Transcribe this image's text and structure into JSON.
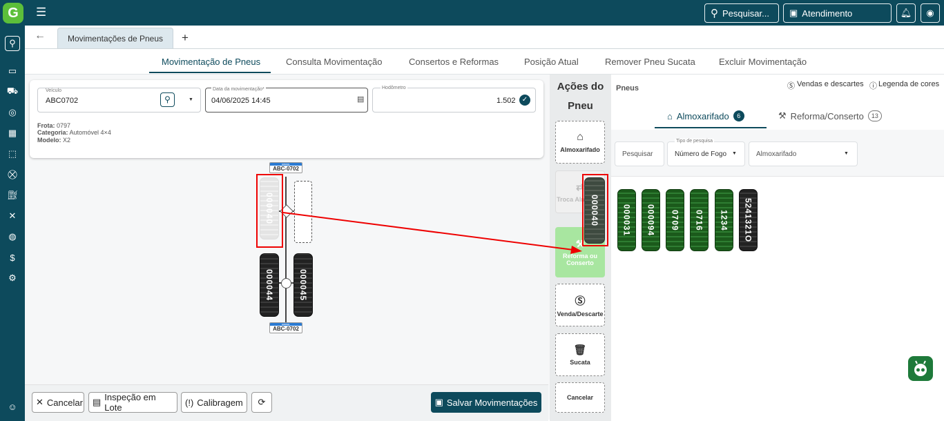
{
  "brand_colors": {
    "primary": "#0d4a5c",
    "accent": "#5cbf3a",
    "highlight": "#e00000"
  },
  "topbar": {
    "search_label": "Pesquisar...",
    "support_label": "Atendimento"
  },
  "sidebar": {
    "icons": [
      "search-icon",
      "archive-icon",
      "truck-icon",
      "tire-icon",
      "calculator-icon",
      "box-icon",
      "cart-icon",
      "fuel-icon",
      "tools-icon",
      "tires-icon",
      "document-money-icon",
      "settings-icon",
      "user-support-icon"
    ]
  },
  "tabs": {
    "active_label": "Movimentações de Pneus",
    "add": "+"
  },
  "subnav": {
    "items": [
      "Movimentação de Pneus",
      "Consulta Movimentação",
      "Consertos e Reformas",
      "Posição Atual",
      "Remover Pneu Sucata",
      "Excluir Movimentação"
    ]
  },
  "form": {
    "vehicle_label": "Veículo",
    "vehicle_value": "ABC0702",
    "date_label": "Data da movimentação*",
    "date_value": "04/06/2025 14:45",
    "odometer_label": "Hodômetro",
    "odometer_value": "1.502"
  },
  "vehicle_info": {
    "frota_label": "Frota:",
    "frota": "0797",
    "categoria_label": "Categoria:",
    "categoria": "Automóvel 4×4",
    "modelo_label": "Modelo:",
    "modelo": "X2"
  },
  "diagram": {
    "plate": "ABC-0702",
    "plate_country": "BRASIL",
    "tire_front_left": "000040",
    "tire_rear_left": "000044",
    "tire_rear_right": "000045"
  },
  "bottom": {
    "cancel": "Cancelar",
    "batch": "Inspeção em Lote",
    "calibration": "Calibragem",
    "save": "Salvar Movimentações"
  },
  "actions": {
    "title_line1": "Ações do",
    "title_line2": "Pneu",
    "almox": "Almoxarifado",
    "troca": "Troca Almoxarif",
    "reforma": "Reforma ou Conserto",
    "venda": "Venda/Descarte",
    "sucata": "Sucata",
    "cancelar": "Cancelar"
  },
  "right": {
    "header": "Pneus",
    "sales_link": "Vendas e descartes",
    "legend_link": "Legenda de cores",
    "tab_almox": "Almoxarifado",
    "tab_almox_count": "6",
    "tab_reforma": "Reforma/Conserto",
    "tab_reforma_count": "13",
    "search_placeholder": "Pesquisar",
    "search_type_label": "Tipo de pesquisa",
    "search_type_value": "Número de Fogo",
    "location_value": "Almoxarifado",
    "dragged_tire": "000040",
    "tires": [
      "000031",
      "000094",
      "0709",
      "0716",
      "1234",
      "5241321O"
    ]
  }
}
